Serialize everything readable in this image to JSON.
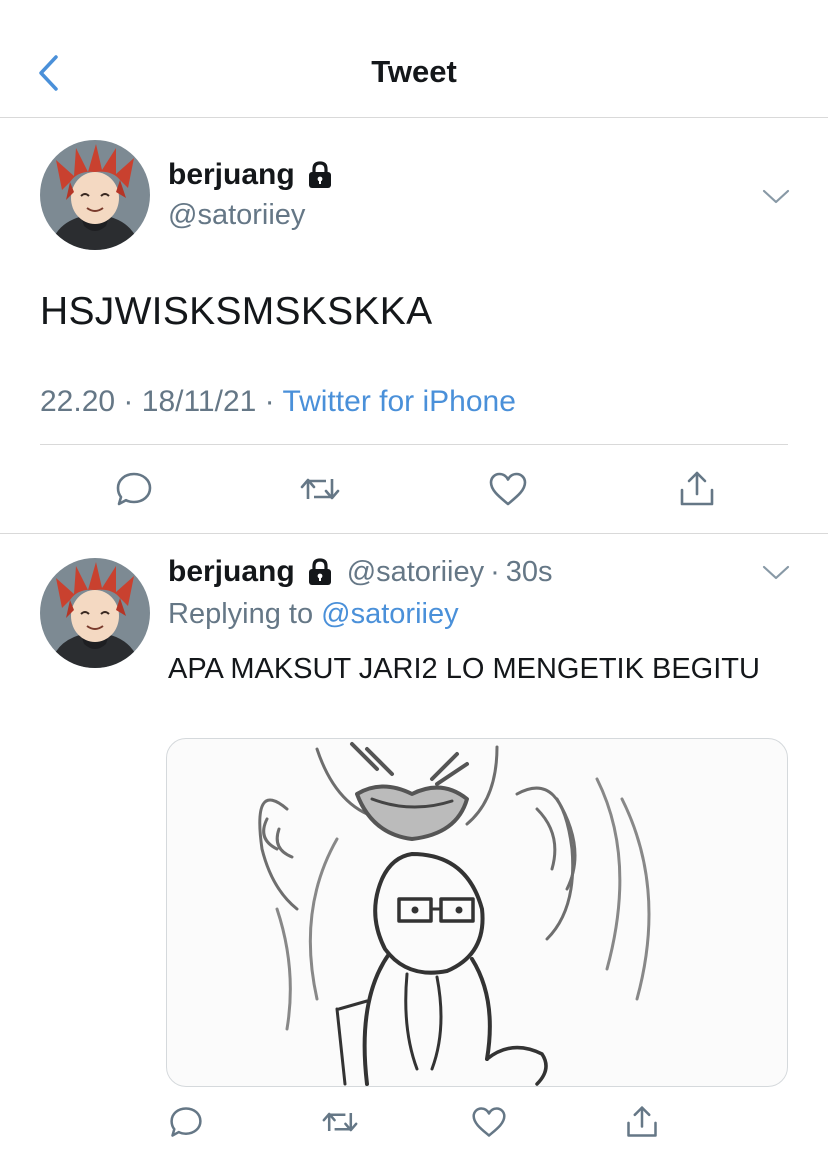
{
  "header": {
    "title": "Tweet"
  },
  "tweet": {
    "display_name": "berjuang",
    "handle": "@satoriiey",
    "text": "HSJWISKSMSKSKKA",
    "time": "22.20",
    "date": "18/11/21",
    "separator": "·",
    "source": "Twitter for iPhone"
  },
  "reply": {
    "display_name": "berjuang",
    "handle": "@satoriiey",
    "age": "30s",
    "separator": "·",
    "replying_prefix": "Replying to",
    "replying_to": "@satoriiey",
    "text": "APA MAKSUT JARI2 LO MENGETIK BEGITU"
  },
  "icons": {
    "back": "chevron-left-icon",
    "lock": "lock-icon",
    "caret": "chevron-down-icon",
    "reply": "reply-icon",
    "retweet": "retweet-icon",
    "like": "heart-icon",
    "share": "share-icon"
  },
  "colors": {
    "accent": "#4a90d9",
    "secondary_text": "#657786",
    "divider": "#d9d9d9"
  }
}
